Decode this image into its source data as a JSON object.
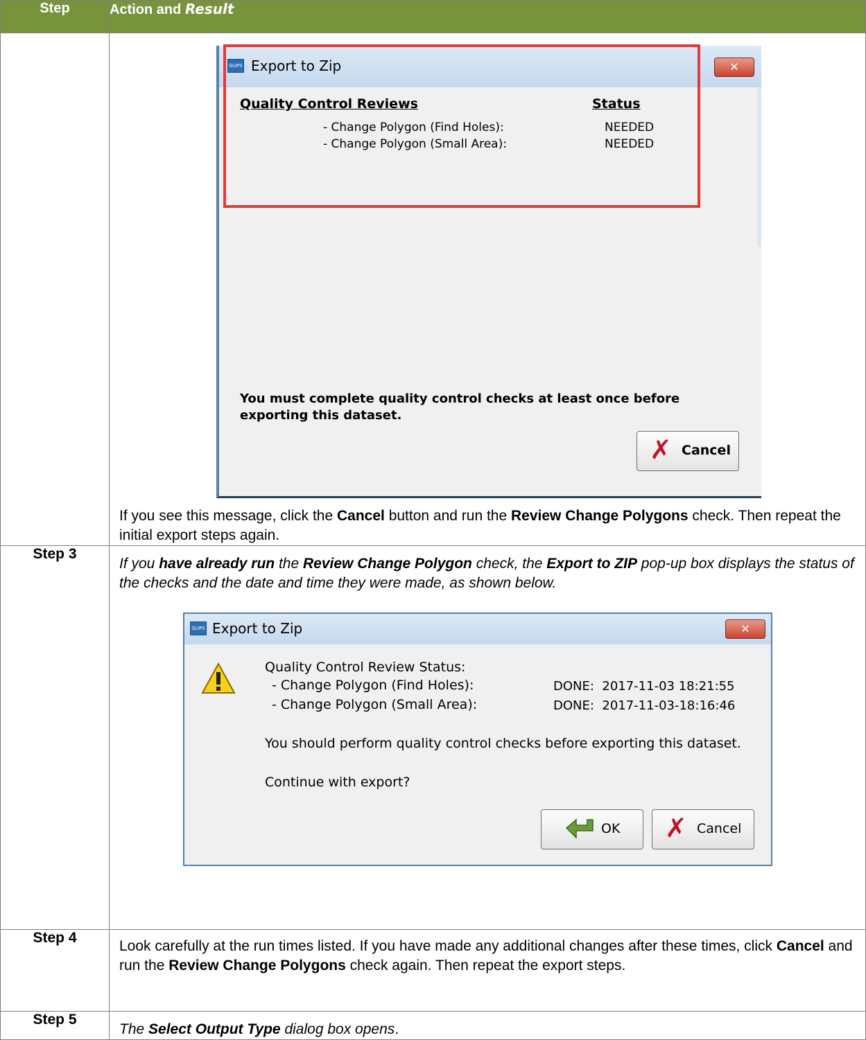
{
  "header": {
    "step": "Step",
    "action_plain": "Action and ",
    "action_italic": "Result"
  },
  "row1": {
    "dialog": {
      "title": "Export to Zip",
      "app_icon": "GUPS",
      "close_icon": "close-icon",
      "col_reviews": "Quality Control Reviews",
      "col_status": "Status",
      "items": [
        {
          "label": "- Change Polygon (Find Holes):",
          "status": "NEEDED"
        },
        {
          "label": "- Change Polygon (Small Area):",
          "status": "NEEDED"
        }
      ],
      "message_line1": "You must complete quality control checks at least once before",
      "message_line2": "exporting this dataset.",
      "cancel_label": "Cancel"
    },
    "para": {
      "t1": "If you see this message, click the ",
      "b1": "Cancel",
      "t2": " button and run the ",
      "b2": "Review Change Polygons",
      "t3": " check. Then repeat the initial export steps again."
    }
  },
  "row2": {
    "step": "Step 3",
    "para": {
      "t1": "If you ",
      "b1": "have already run",
      "t2": " the ",
      "b2": "Review Change Polygon",
      "t3": " check, the ",
      "b3": "Export to ZIP",
      "t4": " pop-up box displays the status of the checks and the date and time they were made, as shown below."
    },
    "dialog": {
      "title": "Export to Zip",
      "app_icon": "GUPS",
      "heading": "Quality Control Review Status:",
      "items": [
        {
          "label": "- Change Polygon (Find Holes):",
          "status": "DONE:  2017-11-03 18:21:55"
        },
        {
          "label": "- Change Polygon (Small Area):",
          "status": "DONE:  2017-11-03-18:16:46"
        }
      ],
      "message": "You should perform quality control checks before exporting this dataset.",
      "question": "Continue with export?",
      "ok_label": "OK",
      "cancel_label": "Cancel"
    }
  },
  "row3": {
    "step": "Step 4",
    "para": {
      "t1": "Look carefully at the run times listed. If you have made any additional changes after these times, click ",
      "b1": "Cancel",
      "t2": " and run the ",
      "b2": "Review Change Polygons",
      "t3": " check again. Then repeat the export steps."
    }
  },
  "row4": {
    "step": "Step 5",
    "para": {
      "t1": "The ",
      "b1": "Select Output Type",
      "t2": " dialog box opens",
      "t3": "."
    }
  }
}
